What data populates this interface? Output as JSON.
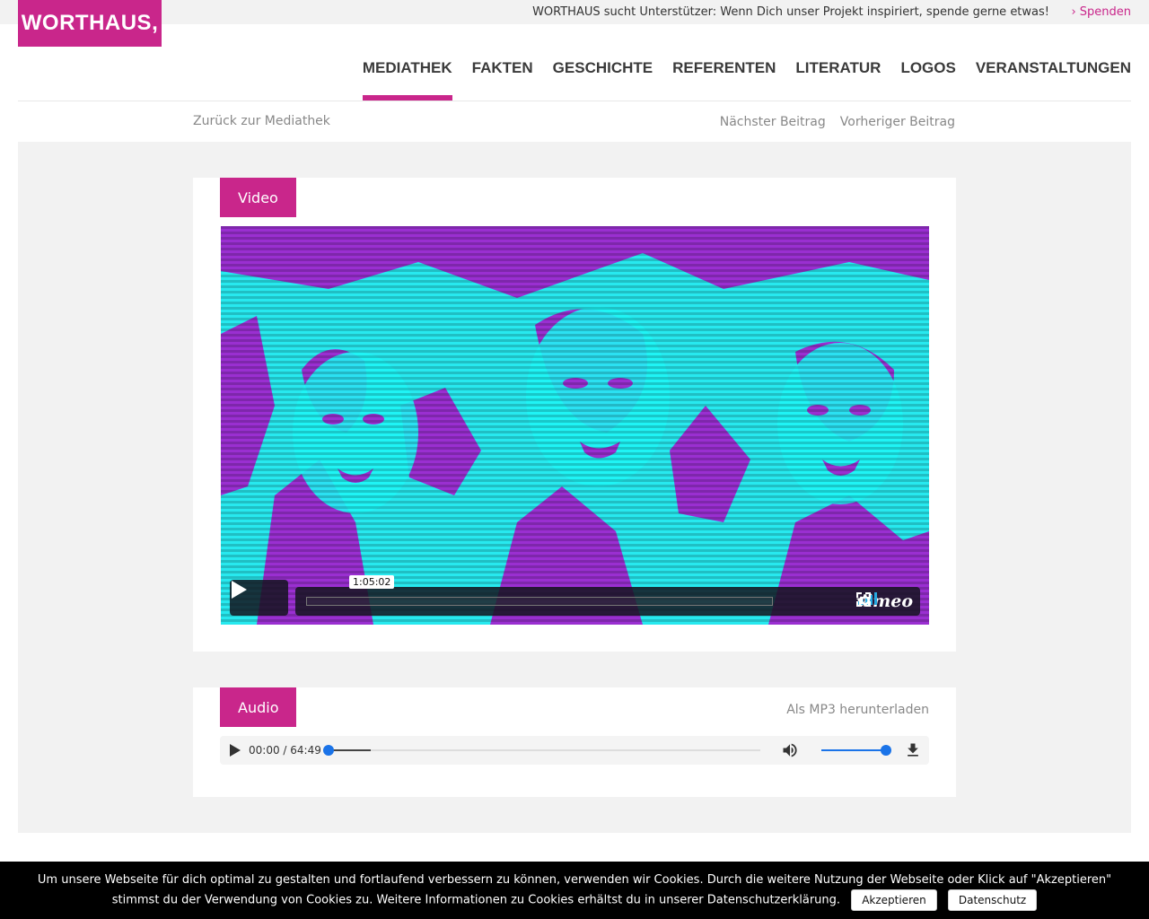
{
  "topbar": {
    "message": "WORTHAUS sucht Unterstützer: Wenn Dich unser Projekt inspiriert, spende gerne etwas!",
    "donate_link": "› Spenden"
  },
  "logo": {
    "text": "WORTHAUS,"
  },
  "nav": {
    "items": [
      "MEDIATHEK",
      "FAKTEN",
      "GESCHICHTE",
      "REFERENTEN",
      "LITERATUR",
      "LOGOS",
      "VERANSTALTUNGEN"
    ],
    "active": "MEDIATHEK"
  },
  "subnav": {
    "back": "Zurück zur Mediathek",
    "next": "Nächster Beitrag",
    "prev": "Vorheriger Beitrag"
  },
  "video": {
    "tag": "Video",
    "duration_popup": "1:05:02",
    "brand": "vimeo",
    "icons": [
      "play-icon",
      "volume-bars-icon",
      "settings-gear-icon",
      "fullscreen-icon"
    ]
  },
  "audio": {
    "tag": "Audio",
    "download_link": "Als MP3 herunterladen",
    "time": "00:00 / 64:49",
    "icons": [
      "play-icon",
      "volume-icon",
      "download-icon"
    ]
  },
  "cookie": {
    "message": "Um unsere Webseite für dich optimal zu gestalten und fortlaufend verbessern zu können, verwenden wir Cookies. Durch die weitere Nutzung der Webseite oder Klick auf \"Akzeptieren\" stimmst du der Verwendung von Cookies zu. Weitere Informationen zu Cookies erhältst du in unserer Datenschutzerklärung.",
    "accept": "Akzeptieren",
    "privacy": "Datenschutz"
  },
  "colors": {
    "brand": "#c9268b",
    "video_cyan": "#27e9ef",
    "video_purple": "#9a2fd1",
    "audio_accent": "#1a73e8"
  }
}
